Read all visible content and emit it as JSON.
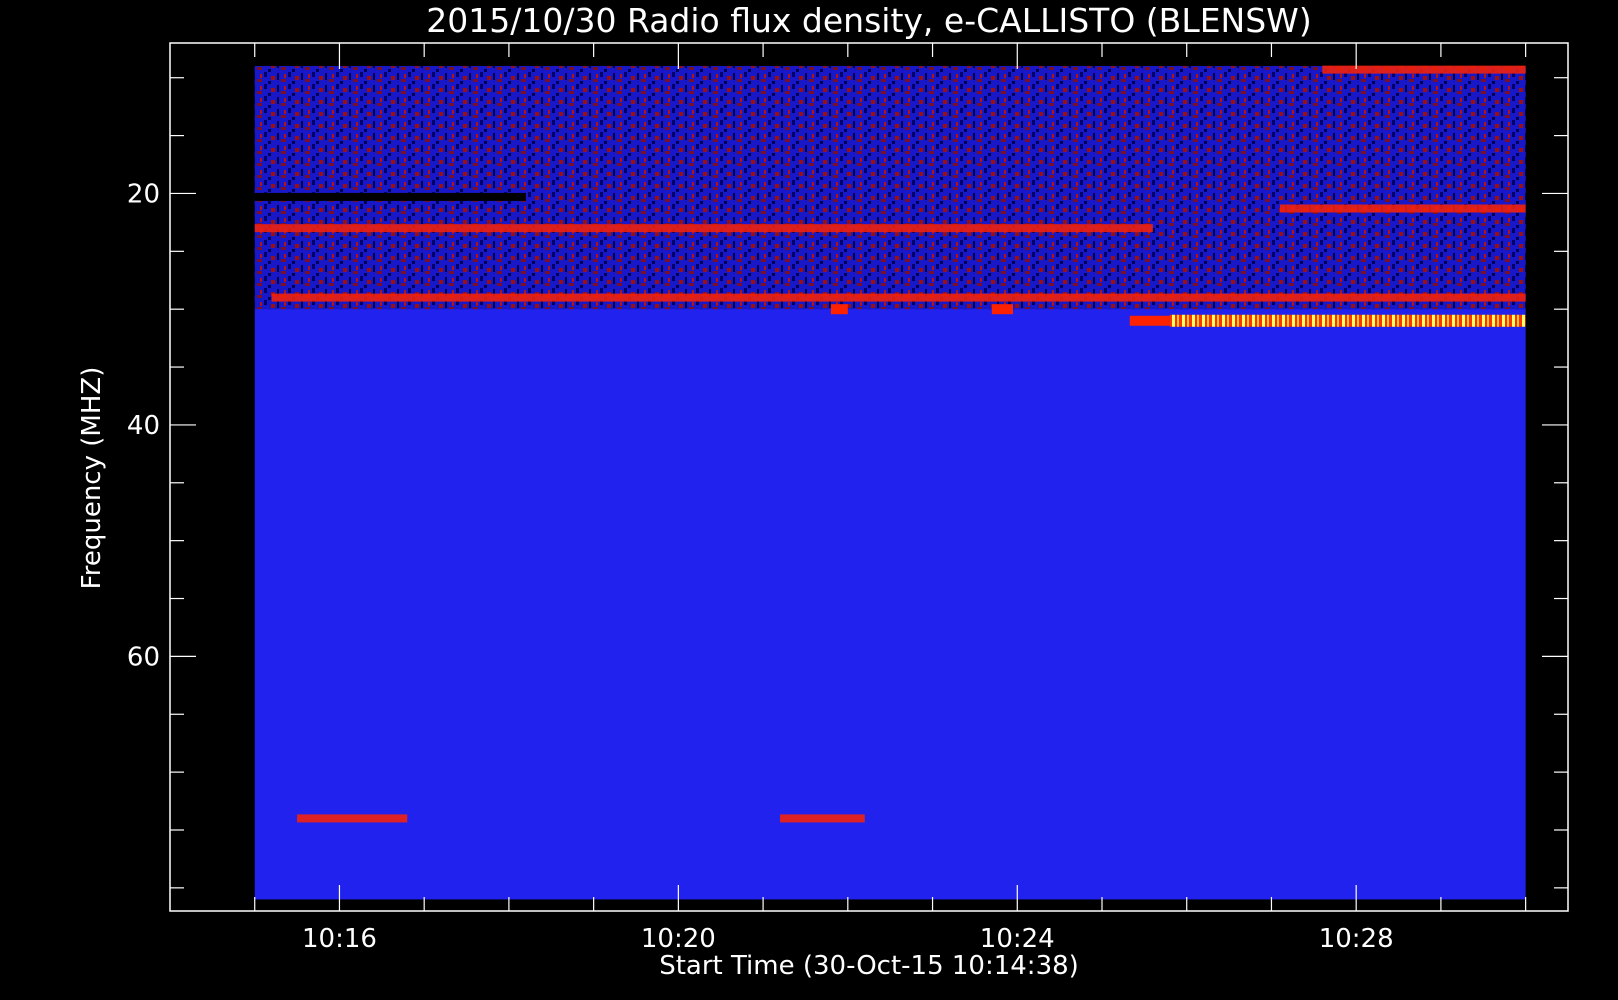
{
  "chart_data": {
    "type": "heatmap",
    "title": "2015/10/30  Radio flux density, e-CALLISTO (BLENSW)",
    "xlabel": "Start Time (30-Oct-15 10:14:38)",
    "ylabel": "Frequency (MHZ)",
    "x_range_minutes": [
      -1.0,
      15.5
    ],
    "y_range": [
      7,
      82
    ],
    "x_ticks": [
      {
        "label": "10:16",
        "minutes": 1.0
      },
      {
        "label": "10:20",
        "minutes": 5.0
      },
      {
        "label": "10:24",
        "minutes": 9.0
      },
      {
        "label": "10:28",
        "minutes": 13.0
      }
    ],
    "x_minor_minutes": [
      0,
      1,
      2,
      3,
      4,
      5,
      6,
      7,
      8,
      9,
      10,
      11,
      12,
      13,
      14,
      15
    ],
    "y_ticks": [
      20,
      40,
      60
    ],
    "y_minor": [
      10,
      15,
      20,
      25,
      30,
      35,
      40,
      45,
      50,
      55,
      60,
      65,
      70,
      75,
      80
    ],
    "data_extent": {
      "minutes": [
        0.0,
        15.0
      ],
      "mhz": [
        9,
        81
      ]
    },
    "colors": {
      "background": "#000000",
      "axes": "#ffffff",
      "plot_blue": "#2222ee",
      "noise_dark": "#000066",
      "noise_red": "#aa1111",
      "burst_red": "#ff2200",
      "burst_yellow": "#ffff66"
    },
    "features": [
      {
        "kind": "noisy_band",
        "mhz": [
          9,
          30
        ],
        "minutes": [
          0.0,
          15.0
        ]
      },
      {
        "kind": "dark_line",
        "mhz": 20.3,
        "minutes": [
          0.0,
          3.2
        ]
      },
      {
        "kind": "red_line",
        "mhz": 23.0,
        "minutes": [
          0.0,
          10.6
        ]
      },
      {
        "kind": "red_line",
        "mhz": 29.0,
        "minutes": [
          0.2,
          15.0
        ]
      },
      {
        "kind": "red_line",
        "mhz": 21.3,
        "minutes": [
          12.1,
          15.0
        ]
      },
      {
        "kind": "red_line",
        "mhz": 9.3,
        "minutes": [
          12.6,
          15.0
        ]
      },
      {
        "kind": "red_line",
        "mhz": 74.0,
        "minutes": [
          0.5,
          1.8
        ]
      },
      {
        "kind": "red_line",
        "mhz": 74.0,
        "minutes": [
          6.2,
          7.2
        ]
      },
      {
        "kind": "bright_burst",
        "mhz": 31.0,
        "minutes": [
          10.8,
          15.0
        ]
      },
      {
        "kind": "red_spot",
        "mhz": 30.0,
        "minutes": [
          6.8,
          7.0
        ]
      },
      {
        "kind": "red_spot",
        "mhz": 30.0,
        "minutes": [
          8.7,
          8.95
        ]
      }
    ]
  }
}
